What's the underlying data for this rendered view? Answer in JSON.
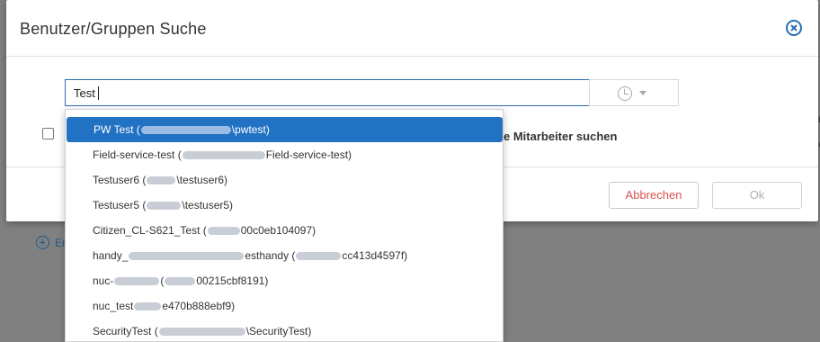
{
  "dialog": {
    "title": "Benutzer/Gruppen Suche",
    "search_value": "Test",
    "checkbox_label": "e Mitarbeiter suchen",
    "cancel_label": "Abbrechen",
    "ok_label": "Ok"
  },
  "background": {
    "add_label": "Er",
    "edge_text_1": "r",
    "edge_text_2": "e"
  },
  "dropdown": {
    "items": [
      {
        "prefix": "PW Test (",
        "suffix": "\\pwtest)"
      },
      {
        "prefix": "Field-service-test (",
        "suffix": "Field-service-test)"
      },
      {
        "prefix": "Testuser6 (",
        "suffix": "\\testuser6)"
      },
      {
        "prefix": "Testuser5 (",
        "suffix": "\\testuser5)"
      },
      {
        "prefix": "Citizen_CL-S621_Test (",
        "suffix": "00c0eb104097)"
      },
      {
        "prefix": "handy_",
        "middle": "esthandy (",
        "suffix": "cc413d4597f)"
      },
      {
        "prefix": "nuc-",
        "middle": "(",
        "suffix": "00215cbf8191)"
      },
      {
        "prefix": "nuc_test",
        "suffix": "e470b888ebf9)"
      },
      {
        "prefix": "SecurityTest (",
        "suffix": "\\SecurityTest)"
      }
    ]
  },
  "colors": {
    "accent": "#2272c3",
    "cancel": "#d9534f",
    "overlay": "#808080"
  }
}
